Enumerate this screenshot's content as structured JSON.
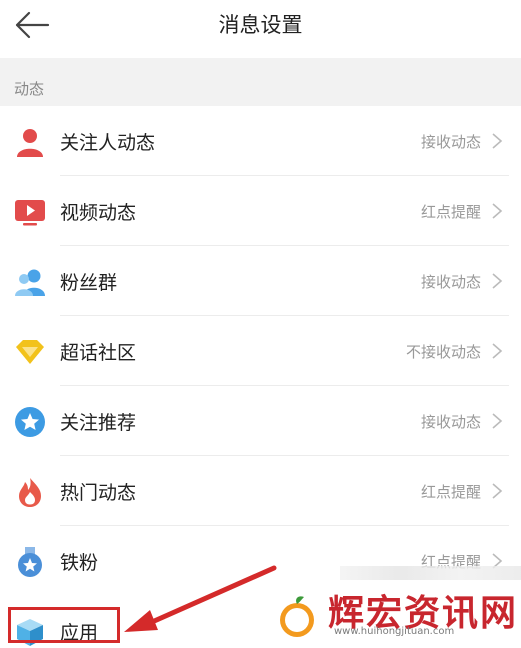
{
  "header": {
    "title": "消息设置",
    "back_icon": "back-arrow-icon"
  },
  "section": {
    "label": "动态"
  },
  "items": [
    {
      "label": "关注人动态",
      "value": "接收动态",
      "icon": "person-icon",
      "color": "#e24b4b"
    },
    {
      "label": "视频动态",
      "value": "红点提醒",
      "icon": "video-icon",
      "color": "#e24b4b"
    },
    {
      "label": "粉丝群",
      "value": "接收动态",
      "icon": "fans-group-icon",
      "color": "#4aa3e8"
    },
    {
      "label": "超话社区",
      "value": "不接收动态",
      "icon": "diamond-icon",
      "color": "#f2c21b"
    },
    {
      "label": "关注推荐",
      "value": "接收动态",
      "icon": "star-icon",
      "color": "#3d9be3"
    },
    {
      "label": "热门动态",
      "value": "红点提醒",
      "icon": "flame-icon",
      "color": "#e85a4a"
    },
    {
      "label": "铁粉",
      "value": "红点提醒",
      "icon": "medal-icon",
      "color": "#4a8fd8"
    },
    {
      "label": "应用",
      "value": "",
      "icon": "app-cube-icon",
      "color": "#4fb1e6"
    }
  ],
  "watermark": {
    "name": "辉宏资讯网",
    "url": "www.huihongjituan.com"
  },
  "colors": {
    "highlight": "#d42a2a",
    "accent": "#c8262e"
  }
}
